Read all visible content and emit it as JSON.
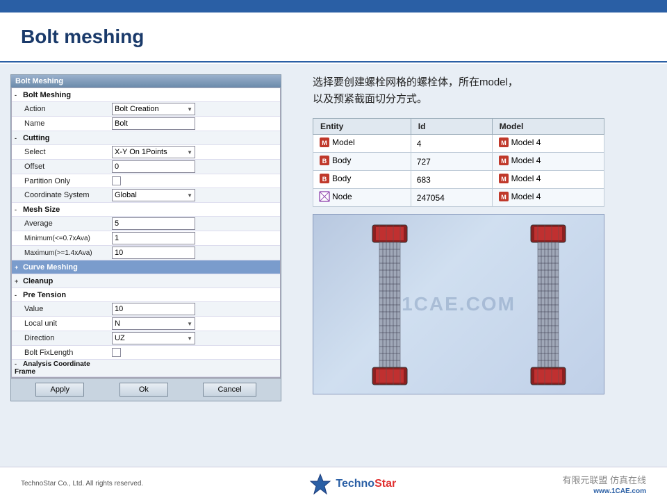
{
  "header": {
    "title": "Bolt meshing"
  },
  "dialog": {
    "title": "Bolt Meshing",
    "sections": [
      {
        "type": "section",
        "label": "-Bolt Meshing",
        "indent": 0
      },
      {
        "type": "row",
        "label": "Action",
        "value": "Bolt Creation",
        "inputType": "dropdown",
        "indent": 1
      },
      {
        "type": "row",
        "label": "Name",
        "value": "Bolt",
        "inputType": "text",
        "indent": 1
      },
      {
        "type": "section",
        "label": "-Cutting",
        "indent": 0
      },
      {
        "type": "row",
        "label": "Select",
        "value": "X-Y On 1Points",
        "inputType": "dropdown",
        "indent": 1
      },
      {
        "type": "row",
        "label": "Offset",
        "value": "0",
        "inputType": "text",
        "indent": 1
      },
      {
        "type": "row",
        "label": "Partition Only",
        "value": "",
        "inputType": "checkbox",
        "indent": 1
      },
      {
        "type": "row",
        "label": "Coordinate System",
        "value": "Global",
        "inputType": "dropdown",
        "indent": 1
      },
      {
        "type": "section",
        "label": "-Mesh Size",
        "indent": 0
      },
      {
        "type": "row",
        "label": "Average",
        "value": "5",
        "inputType": "text",
        "indent": 1
      },
      {
        "type": "row",
        "label": "Minimum(<=0.7xAva)",
        "value": "1",
        "inputType": "text",
        "indent": 1
      },
      {
        "type": "row",
        "label": "Maximum(>=1.4xAva)",
        "value": "10",
        "inputType": "text",
        "indent": 1
      },
      {
        "type": "special",
        "label": "+Curve Meshing",
        "indent": 0
      },
      {
        "type": "section",
        "label": "+Cleanup",
        "indent": 0
      },
      {
        "type": "section",
        "label": "-Pre Tension",
        "indent": 0
      },
      {
        "type": "row",
        "label": "Value",
        "value": "10",
        "inputType": "text",
        "indent": 1
      },
      {
        "type": "row",
        "label": "Local unit",
        "value": "N",
        "inputType": "dropdown",
        "indent": 1
      },
      {
        "type": "row",
        "label": "Direction",
        "value": "UZ",
        "inputType": "dropdown",
        "indent": 1
      },
      {
        "type": "row",
        "label": "Bolt FixLength",
        "value": "",
        "inputType": "checkbox",
        "indent": 1
      },
      {
        "type": "section",
        "label": "-Analysis Coordinate Frame",
        "indent": 0
      }
    ],
    "buttons": [
      "Apply",
      "Ok",
      "Cancel"
    ]
  },
  "description": {
    "line1": "选择要创建螺栓网格的螺栓体，所在model，",
    "line2": "以及预紧截面切分方式。"
  },
  "entity_table": {
    "headers": [
      "Entity",
      "Id",
      "Model"
    ],
    "rows": [
      {
        "icon": "model",
        "entity": "Model",
        "id": "4",
        "model_icon": "model",
        "model": "Model 4"
      },
      {
        "icon": "body",
        "entity": "Body",
        "id": "727",
        "model_icon": "model",
        "model": "Model 4"
      },
      {
        "icon": "body",
        "entity": "Body",
        "id": "683",
        "model_icon": "model",
        "model": "Model 4"
      },
      {
        "icon": "node",
        "entity": "Node",
        "id": "247054",
        "model_icon": "model",
        "model": "Model 4"
      }
    ]
  },
  "footer": {
    "copyright": "TechnoStar Co., Ltd. All rights reserved.",
    "logo_prefix": "Techno",
    "logo_suffix": "Star",
    "watermark1": "有限元联盟",
    "watermark2": "仿真在线",
    "url": "www.1CAE.com"
  }
}
